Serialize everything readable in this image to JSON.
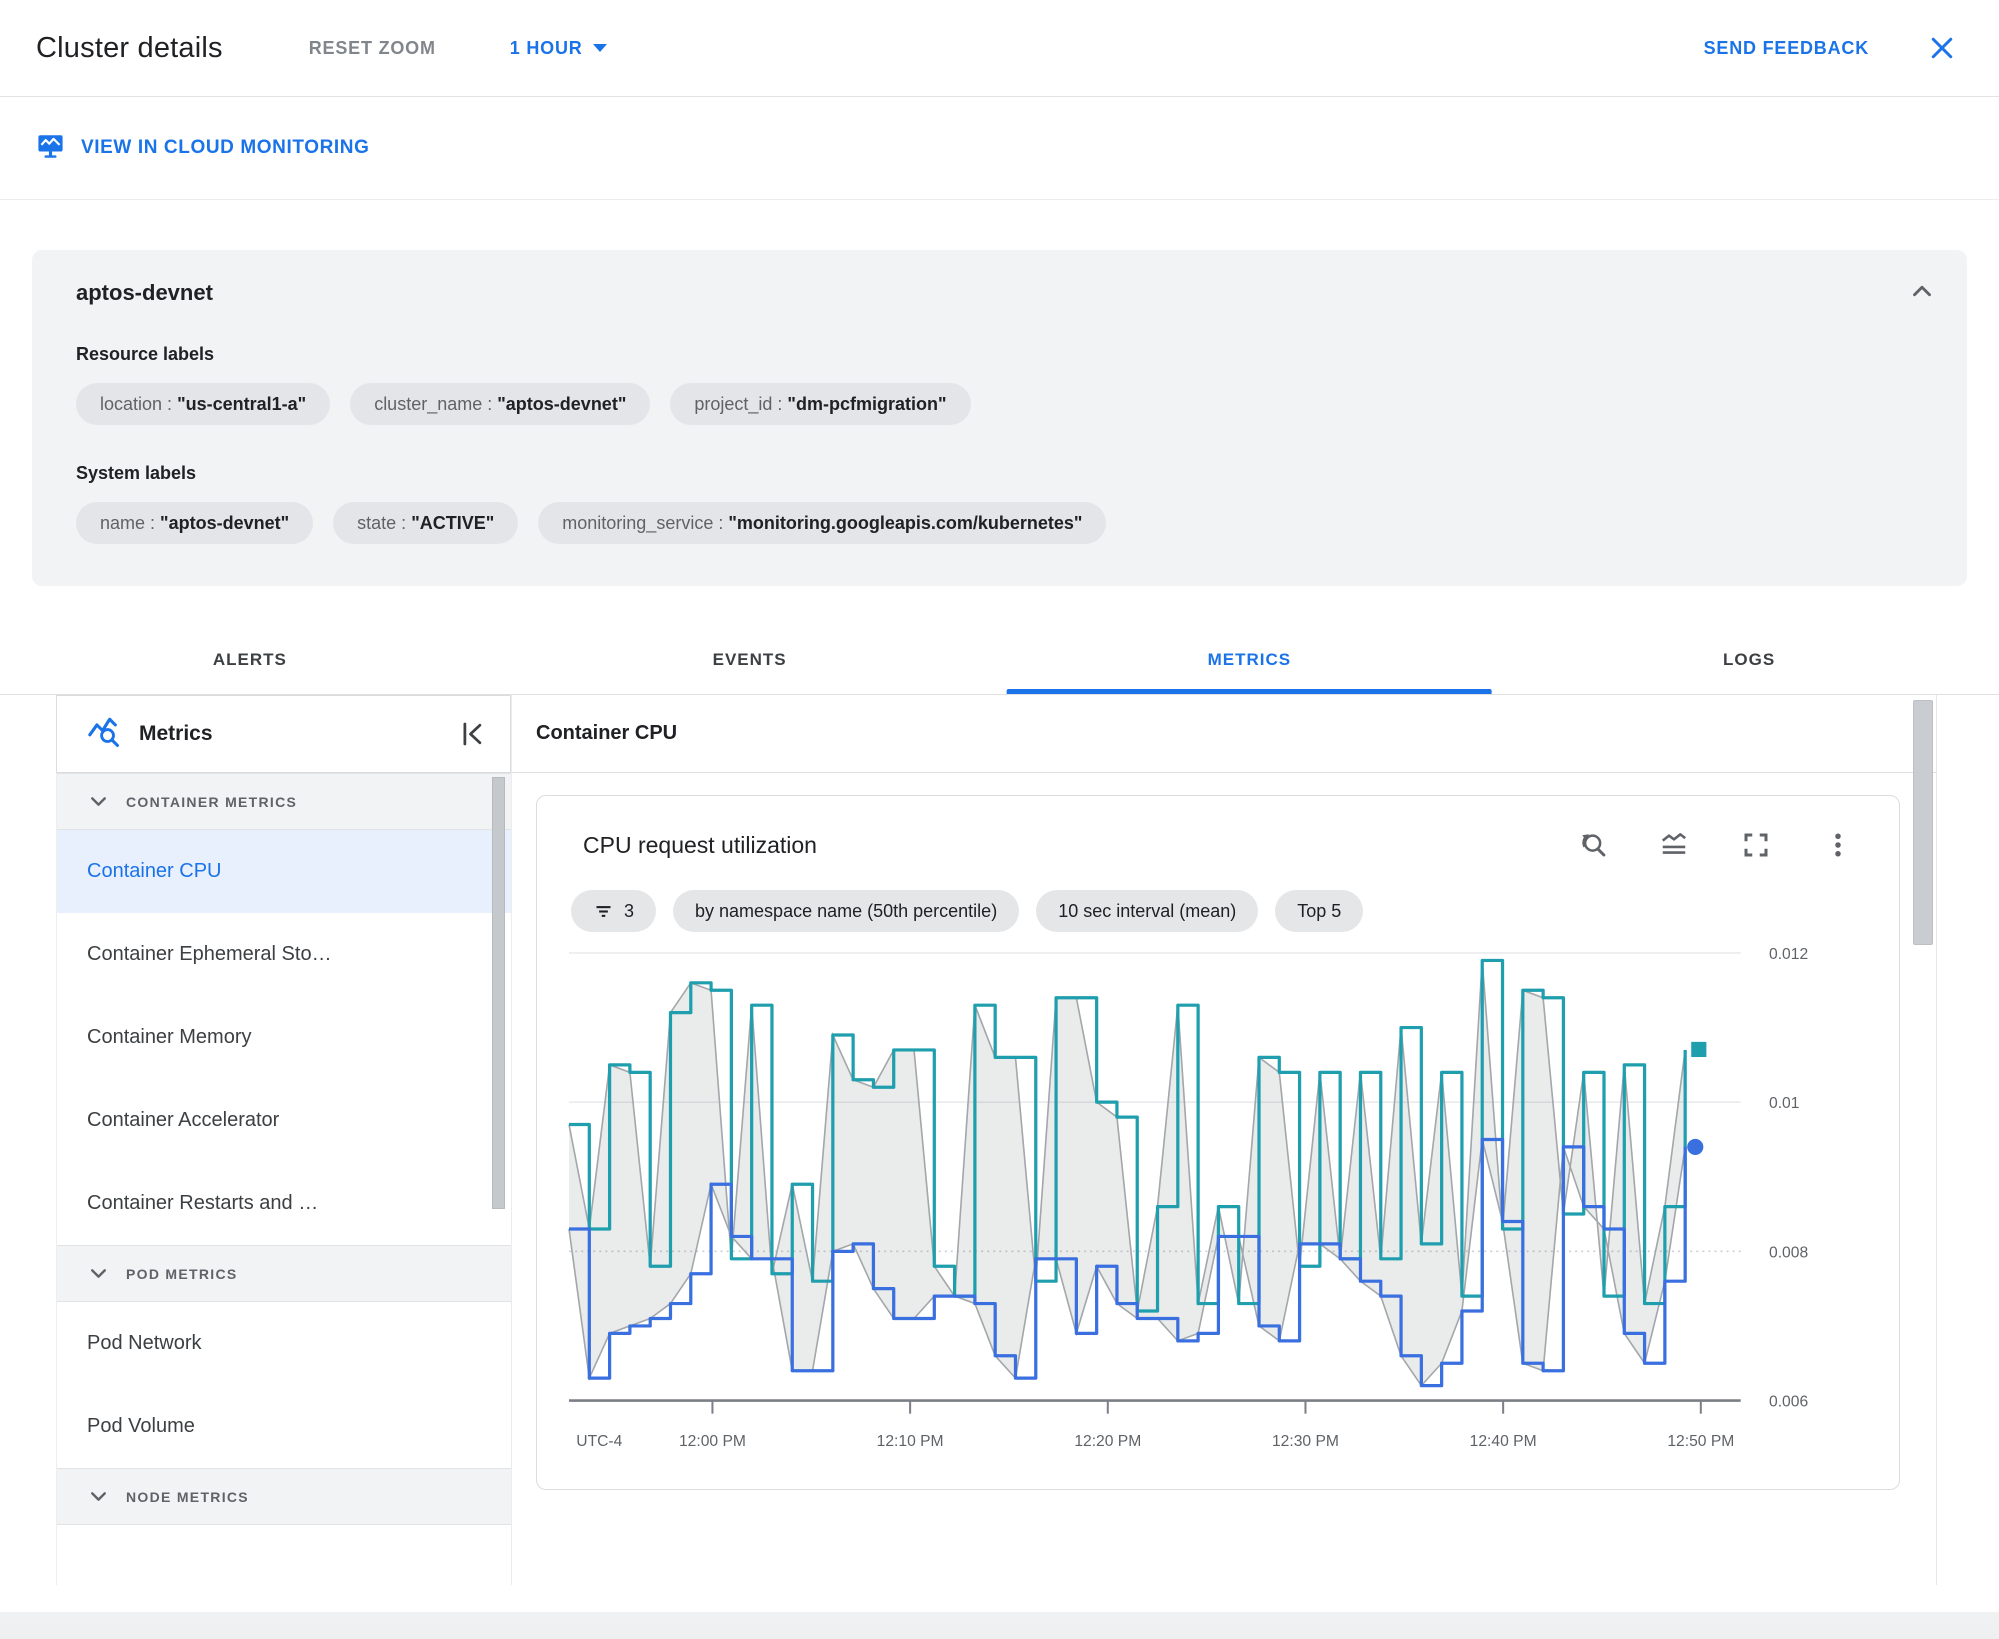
{
  "header": {
    "title": "Cluster details",
    "reset_zoom_label": "RESET ZOOM",
    "time_range_value": "1 HOUR",
    "send_feedback_label": "SEND FEEDBACK"
  },
  "monitoring_link": {
    "label": "VIEW IN CLOUD MONITORING"
  },
  "cluster_card": {
    "name": "aptos-devnet",
    "key_value_separator": " : ",
    "resource_labels_title": "Resource labels",
    "resource_labels": [
      {
        "key": "location",
        "value": "\"us-central1-a\""
      },
      {
        "key": "cluster_name",
        "value": "\"aptos-devnet\""
      },
      {
        "key": "project_id",
        "value": "\"dm-pcfmigration\""
      }
    ],
    "system_labels_title": "System labels",
    "system_labels": [
      {
        "key": "name",
        "value": "\"aptos-devnet\""
      },
      {
        "key": "state",
        "value": "\"ACTIVE\""
      },
      {
        "key": "monitoring_service",
        "value": "\"monitoring.googleapis.com/kubernetes\""
      }
    ]
  },
  "tabs": {
    "items": [
      {
        "label": "ALERTS",
        "active": false
      },
      {
        "label": "EVENTS",
        "active": false
      },
      {
        "label": "METRICS",
        "active": true
      },
      {
        "label": "LOGS",
        "active": false
      }
    ]
  },
  "sidebar": {
    "title": "Metrics",
    "sections": [
      {
        "header": "CONTAINER METRICS",
        "items": [
          {
            "label": "Container CPU",
            "selected": true
          },
          {
            "label": "Container Ephemeral Sto…",
            "selected": false
          },
          {
            "label": "Container Memory",
            "selected": false
          },
          {
            "label": "Container Accelerator",
            "selected": false
          },
          {
            "label": "Container Restarts and …",
            "selected": false
          }
        ]
      },
      {
        "header": "POD METRICS",
        "items": [
          {
            "label": "Pod Network",
            "selected": false
          },
          {
            "label": "Pod Volume",
            "selected": false
          }
        ]
      },
      {
        "header": "NODE METRICS",
        "items": []
      }
    ]
  },
  "main": {
    "panel_title": "Container CPU",
    "chart_card": {
      "title": "CPU request utilization",
      "chips": [
        {
          "label": "3",
          "icon": "filter-list"
        },
        {
          "label": "by namespace name (50th percentile)"
        },
        {
          "label": "10 sec interval (mean)"
        },
        {
          "label": "Top 5"
        }
      ]
    }
  },
  "chart_data": {
    "type": "line",
    "title": "CPU request utilization",
    "x_axis_timezone": "UTC-4",
    "x_tick_labels": [
      "12:00 PM",
      "12:10 PM",
      "12:20 PM",
      "12:30 PM",
      "12:40 PM",
      "12:50 PM"
    ],
    "y_ticks": [
      0.012,
      0.01,
      0.008
    ],
    "y_tick_labels": [
      "0.012",
      "0.01",
      "0.008"
    ],
    "baseline": {
      "value": 0.006,
      "label": "0.006"
    },
    "ylim": [
      0.006,
      0.0122
    ],
    "grid": true,
    "legend_position": "none",
    "band": {
      "fill": "rgba(95,99,104,0.13)",
      "stroke": "#a3a7ab"
    },
    "series": [
      {
        "id": "teal-series",
        "color": "#1f9fae",
        "line_style": "step",
        "marker": "square",
        "values": [
          0.0097,
          0.0083,
          0.0105,
          0.0104,
          0.0078,
          0.0112,
          0.0116,
          0.0115,
          0.0079,
          0.0113,
          0.0077,
          0.0089,
          0.0076,
          0.0109,
          0.0103,
          0.0102,
          0.0107,
          0.0107,
          0.0078,
          0.0074,
          0.0113,
          0.0106,
          0.0106,
          0.0076,
          0.0114,
          0.0114,
          0.01,
          0.0098,
          0.0072,
          0.0086,
          0.0113,
          0.0073,
          0.0086,
          0.0073,
          0.0106,
          0.0104,
          0.0078,
          0.0104,
          0.0079,
          0.0104,
          0.0079,
          0.011,
          0.0081,
          0.0104,
          0.0074,
          0.0119,
          0.0083,
          0.0115,
          0.0114,
          0.0085,
          0.0104,
          0.0074,
          0.0105,
          0.0073,
          0.0086,
          0.0107
        ]
      },
      {
        "id": "blue-series",
        "color": "#3a6fe0",
        "line_style": "step",
        "marker": "circle",
        "values": [
          0.0083,
          0.0063,
          0.0069,
          0.007,
          0.0071,
          0.0073,
          0.0077,
          0.0089,
          0.0082,
          0.0079,
          0.0079,
          0.0064,
          0.0064,
          0.008,
          0.0081,
          0.0075,
          0.0071,
          0.0071,
          0.0074,
          0.0074,
          0.0073,
          0.0066,
          0.0063,
          0.0079,
          0.0079,
          0.0069,
          0.0078,
          0.0073,
          0.0071,
          0.0071,
          0.0068,
          0.0069,
          0.0082,
          0.0082,
          0.007,
          0.0068,
          0.0081,
          0.0081,
          0.0079,
          0.0076,
          0.0074,
          0.0066,
          0.0062,
          0.0065,
          0.0072,
          0.0095,
          0.0084,
          0.0065,
          0.0064,
          0.0094,
          0.0086,
          0.0083,
          0.0069,
          0.0065,
          0.0076,
          0.0094
        ]
      }
    ]
  }
}
